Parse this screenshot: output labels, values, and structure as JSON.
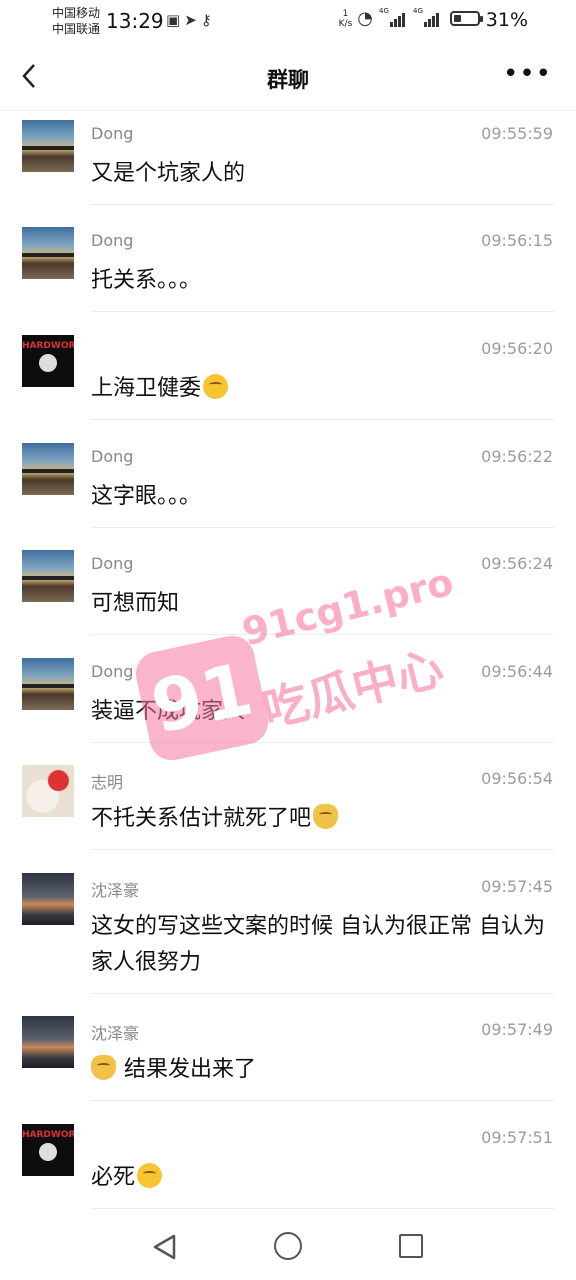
{
  "status_bar": {
    "carrier1": "中国移动",
    "carrier2": "中国联通",
    "time": "13:29",
    "speed_value": "1",
    "speed_unit": "K/s",
    "net1": "4G",
    "net2": "4G",
    "battery_pct": "31%",
    "battery_level": 0.31
  },
  "header": {
    "title": "群聊",
    "more": "•••"
  },
  "messages": [
    {
      "name": "Dong",
      "time": "09:55:59",
      "text": "又是个坑家人的"
    },
    {
      "name": "Dong",
      "time": "09:56:15",
      "text": "托关系。。。"
    },
    {
      "name": "",
      "time": "09:56:20",
      "text": "上海卫健委"
    },
    {
      "name": "Dong",
      "time": "09:56:22",
      "text": "这字眼。。。"
    },
    {
      "name": "Dong",
      "time": "09:56:24",
      "text": "可想而知"
    },
    {
      "name": "Dong",
      "time": "09:56:44",
      "text": "装逼不成坑家人"
    },
    {
      "name": "志明",
      "time": "09:56:54",
      "text": "不托关系估计就死了吧"
    },
    {
      "name": "沈泽豪",
      "time": "09:57:45",
      "text": "这女的写这些文案的时候 自认为很正常 自认为家人很努力"
    },
    {
      "name": "沈泽豪",
      "time": "09:57:49",
      "text": "结果发出来了"
    },
    {
      "name": "",
      "time": "09:57:51",
      "text": "必死"
    }
  ],
  "avatar_hard_text": "HARDWORK",
  "watermark": {
    "badge": "91",
    "site": "91cg1.pro",
    "brand": "吃瓜中心"
  }
}
